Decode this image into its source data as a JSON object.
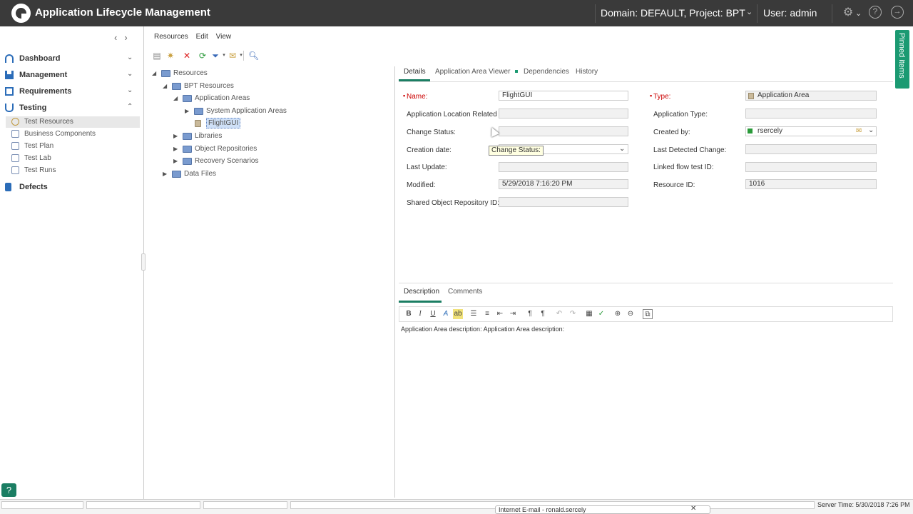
{
  "app": {
    "title": "Application Lifecycle Management"
  },
  "header": {
    "domain_project": "Domain: DEFAULT, Project: BPT",
    "user": "User: admin",
    "icons": [
      "settings-gear-icon",
      "help-circle-icon",
      "logout-icon"
    ]
  },
  "sidebar": {
    "sections": [
      {
        "label": "Dashboard",
        "icon": "dashboard-icon",
        "expanded": false
      },
      {
        "label": "Management",
        "icon": "bar-chart-icon",
        "expanded": false
      },
      {
        "label": "Requirements",
        "icon": "requirements-icon",
        "expanded": false
      },
      {
        "label": "Testing",
        "icon": "flask-icon",
        "expanded": true
      },
      {
        "label": "Defects",
        "icon": "defect-icon",
        "expanded": false
      }
    ],
    "testing_items": [
      {
        "label": "Test Resources",
        "active": true
      },
      {
        "label": "Business Components",
        "active": false
      },
      {
        "label": "Test Plan",
        "active": false
      },
      {
        "label": "Test Lab",
        "active": false
      },
      {
        "label": "Test Runs",
        "active": false
      }
    ]
  },
  "menu": {
    "items": [
      "Resources",
      "Edit",
      "View"
    ]
  },
  "tree": {
    "nodes": [
      {
        "label": "Resources"
      },
      {
        "label": "BPT Resources"
      },
      {
        "label": "Application Areas"
      },
      {
        "label": "System Application Areas"
      },
      {
        "label": "FlightGUI"
      },
      {
        "label": "Libraries"
      },
      {
        "label": "Object Repositories"
      },
      {
        "label": "Recovery Scenarios"
      },
      {
        "label": "Data Files"
      }
    ]
  },
  "details": {
    "tabs": [
      "Details",
      "Application Area Viewer",
      "Dependencies",
      "History"
    ],
    "fields_left": [
      {
        "label": "Name:",
        "value": "FlightGUI",
        "required": true
      },
      {
        "label": "Application Location Related I...",
        "value": ""
      },
      {
        "label": "Change Status:",
        "value": ""
      },
      {
        "label": "Creation date:",
        "value": ""
      },
      {
        "label": "Last Update:",
        "value": ""
      },
      {
        "label": "Modified:",
        "value": "5/29/2018 7:16:20 PM"
      },
      {
        "label": "Shared Object Repository ID:",
        "value": ""
      }
    ],
    "fields_right": [
      {
        "label": "Type:",
        "value": "Application Area",
        "required": true
      },
      {
        "label": "Application Type:",
        "value": ""
      },
      {
        "label": "Created by:",
        "value": "rsercely"
      },
      {
        "label": "Last Detected Change:",
        "value": ""
      },
      {
        "label": "Linked flow test ID:",
        "value": ""
      },
      {
        "label": "Resource ID:",
        "value": "1016"
      }
    ],
    "tooltip": "Change Status:"
  },
  "description": {
    "tabs": [
      "Description",
      "Comments"
    ],
    "text": "Application Area description: Application Area description:"
  },
  "pinned": {
    "label": "Pinned items"
  },
  "status": {
    "server_time": "Server Time: 5/30/2018 7:26 PM",
    "popup": "Internet E-mail - ronald.sercely"
  },
  "colors": {
    "accent": "#1b7e63",
    "topbar": "#3a3a3a",
    "pinned": "#1b9a72"
  }
}
